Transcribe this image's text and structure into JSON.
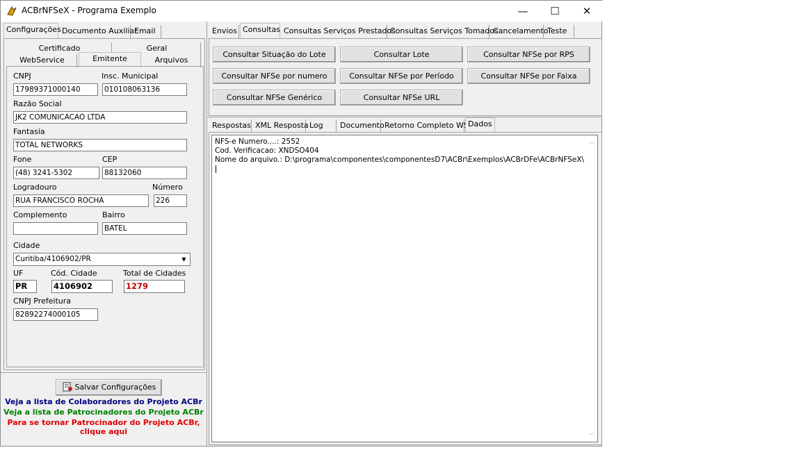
{
  "window": {
    "title": "ACBrNFSeX - Programa Exemplo",
    "minimize": "—",
    "maximize": "☐",
    "close": "✕"
  },
  "left": {
    "tabs": [
      "Configurações",
      "Documento Auxiliar",
      "Email"
    ],
    "subtabs_row1": [
      "Certificado",
      "Geral"
    ],
    "subtabs_row2": [
      "WebService",
      "Emitente",
      "Arquivos"
    ],
    "fields": {
      "cnpj_label": "CNPJ",
      "cnpj": "17989371000140",
      "im_label": "Insc. Municipal",
      "im": "010108063136",
      "razao_label": "Razão Social",
      "razao": "JK2 COMUNICACAO LTDA",
      "fantasia_label": "Fantasia",
      "fantasia": "TOTAL NETWORKS",
      "fone_label": "Fone",
      "fone": "(48) 3241-5302",
      "cep_label": "CEP",
      "cep": "88132060",
      "logradouro_label": "Logradouro",
      "logradouro": "RUA FRANCISCO ROCHA",
      "numero_label": "Número",
      "numero": "226",
      "complemento_label": "Complemento",
      "complemento": "",
      "bairro_label": "Bairro",
      "bairro": "BATEL",
      "cidade_label": "Cidade",
      "cidade": "Curitiba/4106902/PR",
      "uf_label": "UF",
      "uf": "PR",
      "codcidade_label": "Cód. Cidade",
      "codcidade": "4106902",
      "totalcidades_label": "Total de Cidades",
      "totalcidades": "1279",
      "cnpjpref_label": "CNPJ Prefeitura",
      "cnpjpref": "82892274000105"
    },
    "save_button": "Salvar Configurações",
    "links": {
      "colaboradores": "Veja a lista de Colaboradores do Projeto ACBr",
      "patrocinadores": "Veja a lista de Patrocinadores do Projeto ACBr",
      "patrocinar_1": "Para se tornar Patrocinador do Projeto ACBr,",
      "patrocinar_2": "clique aqui"
    }
  },
  "right": {
    "tabs": [
      "Envios",
      "Consultas",
      "Consultas Serviços Prestados",
      "Consultas Serviços Tomados",
      "Cancelamento",
      "Teste"
    ],
    "buttons": [
      "Consultar Situação do Lote",
      "Consultar Lote",
      "Consultar NFSe por RPS",
      "Consultar NFSe por numero",
      "Consultar NFSe por Período",
      "Consultar NFSe por Faixa",
      "Consultar NFSe Genérico",
      "Consultar NFSe URL"
    ],
    "result_tabs": [
      "Respostas",
      "XML Resposta",
      "Log",
      "Documento",
      "Retorno Completo WS",
      "Dados"
    ],
    "memo_lines": [
      "NFS-e Numero....: 2552",
      "Cod. Verificacao: XNDSO404",
      "Nome do arquivo.: D:\\programa\\componentes\\componentesD7\\ACBr\\Exemplos\\ACBrDFe\\ACBrNFSeX\\Delphi\\Lo"
    ]
  },
  "colors": {
    "total_cidades": "#c00000",
    "link_blue": "#000080",
    "link_green": "#008000",
    "link_red": "#e00000"
  }
}
